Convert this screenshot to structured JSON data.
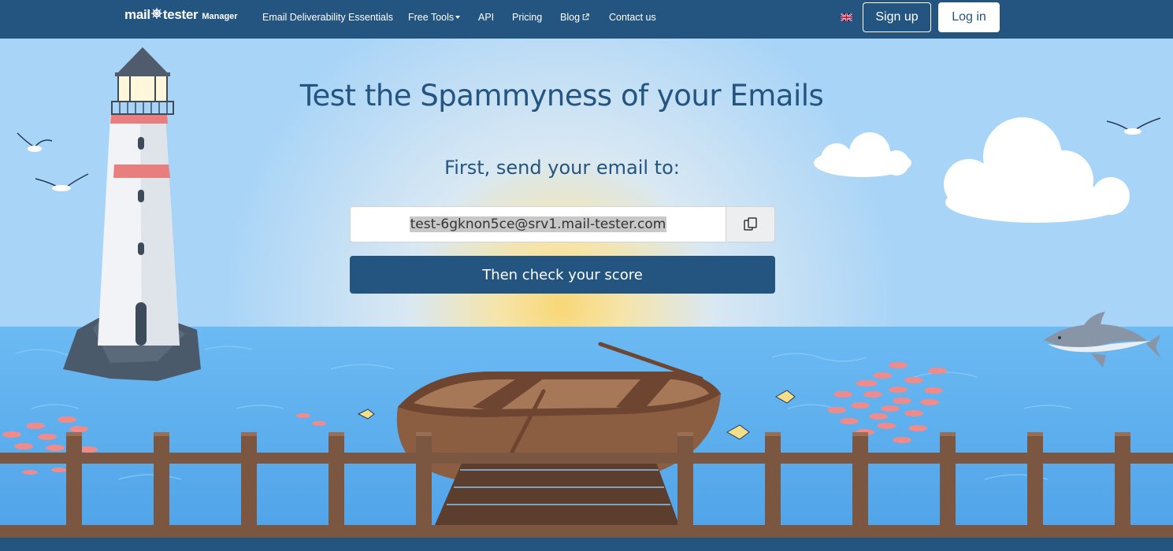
{
  "brand": {
    "name_left": "mail",
    "name_right": "tester",
    "suffix": "Manager"
  },
  "nav": {
    "items": [
      {
        "label": "Email Deliverability Essentials"
      },
      {
        "label": "Free Tools"
      },
      {
        "label": "API"
      },
      {
        "label": "Pricing"
      },
      {
        "label": "Blog"
      },
      {
        "label": "Contact us"
      }
    ],
    "language_icon": "uk-flag-icon",
    "signup_label": "Sign up",
    "login_label": "Log in"
  },
  "hero": {
    "title": "Test the Spammyness of your Emails",
    "subtitle": "First, send your email to:",
    "email_address": "test-6gknon5ce@srv1.mail-tester.com",
    "copy_icon": "copy-icon",
    "check_button_label": "Then check your score"
  },
  "colors": {
    "brand_blue": "#245580",
    "sky": "#a8d4f7",
    "sea": "#5fb0ee",
    "dock_wood": "#7b5741"
  }
}
